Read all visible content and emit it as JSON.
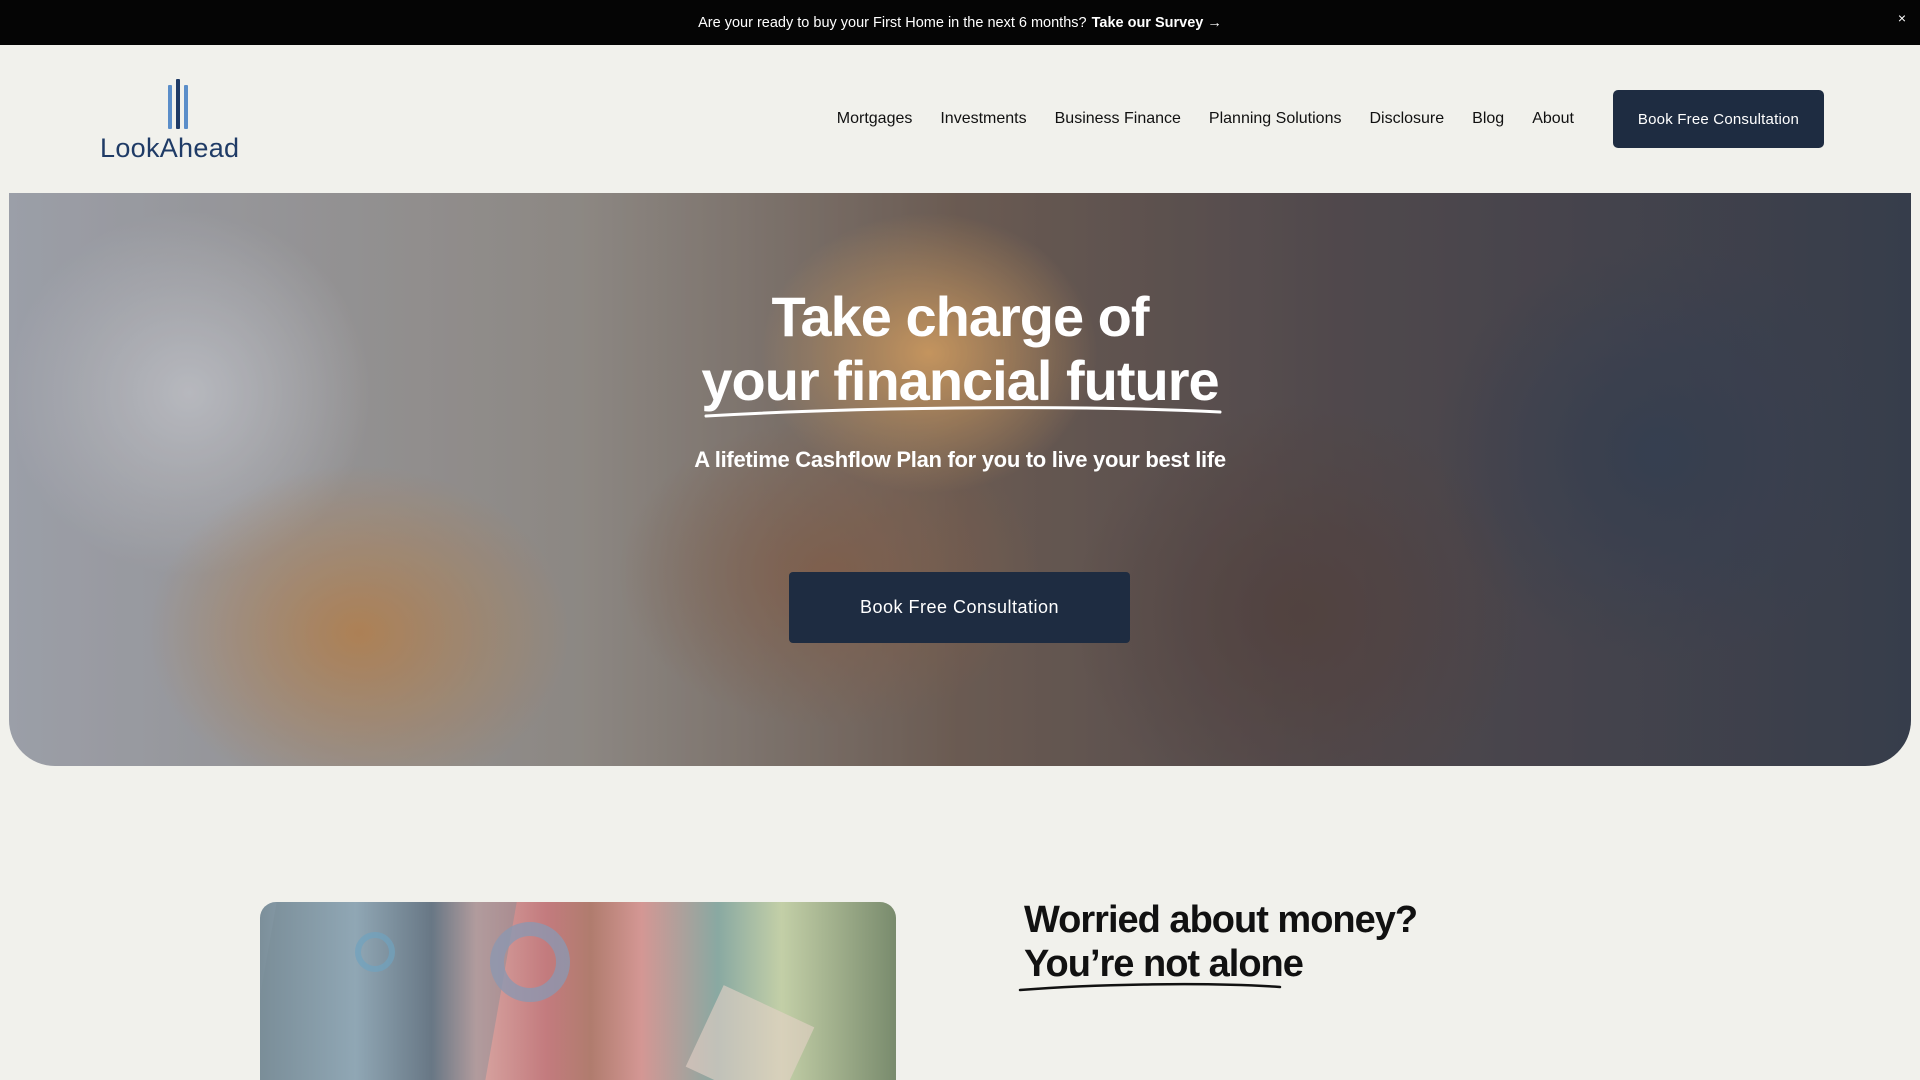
{
  "announcement": {
    "text": "Are your ready to buy your First Home in the next 6 months?",
    "link": "Take our Survey →",
    "close": "×"
  },
  "header": {
    "logo_text": "LookAhead",
    "nav": [
      "Mortgages",
      "Investments",
      "Business Finance",
      "Planning Solutions",
      "Disclosure",
      "Blog",
      "About"
    ],
    "cta": "Book Free Consultation"
  },
  "hero": {
    "title_line1": "Take charge of",
    "title_line2": "your financial future",
    "subtitle": "A lifetime Cashflow Plan for you to live your best life",
    "cta": "Book Free Consultation"
  },
  "section": {
    "heading_line1": "Worried about money?",
    "heading_line2": "You’re not alone"
  },
  "colors": {
    "navy": "#1e2c41",
    "logo_blue": "#1f3b66",
    "logo_light_blue": "#5b8ec9",
    "background": "#f1f1ec",
    "announcement_bg": "#050505"
  }
}
